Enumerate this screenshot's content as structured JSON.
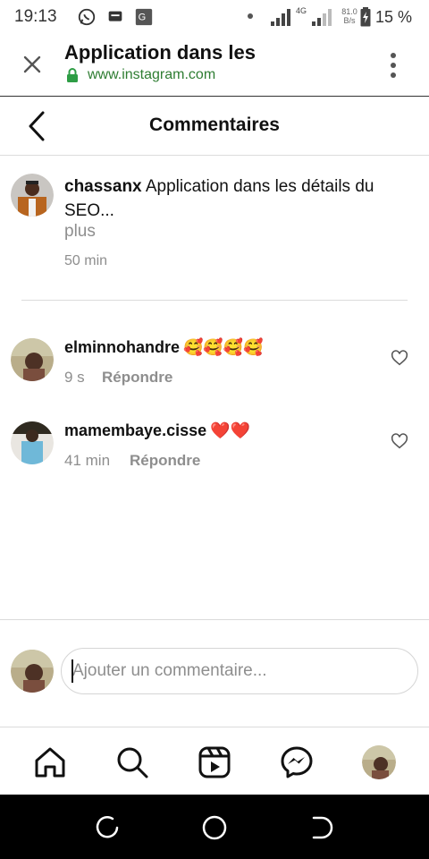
{
  "status_bar": {
    "time": "19:13",
    "network_type": "4G",
    "net_speed_value": "81.0",
    "net_speed_unit": "B/s",
    "battery": "15 %"
  },
  "browser": {
    "page_title": "Application dans les",
    "url": "www.instagram.com"
  },
  "header": {
    "title": "Commentaires"
  },
  "caption": {
    "username": "chassanx",
    "text": "Application dans les détails du SEO...",
    "more_label": "plus",
    "time": "50 min"
  },
  "comments": [
    {
      "username": "elminnohandre",
      "emoji": "🥰🥰🥰🥰",
      "time": "9 s",
      "reply_label": "Répondre"
    },
    {
      "username": "mamembaye.cisse",
      "emoji": "❤️❤️",
      "time": "41 min",
      "reply_label": "Répondre"
    }
  ],
  "comment_input": {
    "placeholder": "Ajouter un commentaire..."
  },
  "bottom_nav": [
    "home-icon",
    "search-icon",
    "reels-icon",
    "messenger-icon",
    "profile-avatar"
  ],
  "colors": {
    "url_green": "#2e7d32",
    "secondary_text": "#8e8e8e"
  }
}
